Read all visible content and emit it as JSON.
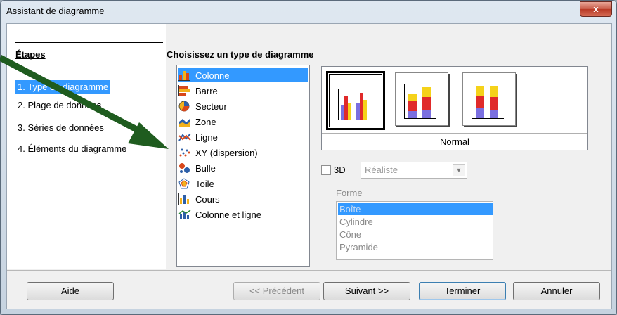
{
  "window": {
    "title": "Assistant de diagramme",
    "close_glyph": "x"
  },
  "steps": {
    "heading": "Étapes",
    "items": [
      {
        "label": "1. Type du diagramme",
        "active": true
      },
      {
        "label": "2. Plage de données",
        "active": false
      },
      {
        "label": "3. Séries de données",
        "active": false
      },
      {
        "label": "4. Éléments du diagramme",
        "active": false
      }
    ]
  },
  "main": {
    "heading": "Choisissez un type de diagramme",
    "types": [
      {
        "label": "Colonne",
        "icon": "column-chart-icon",
        "selected": true
      },
      {
        "label": "Barre",
        "icon": "bar-chart-icon",
        "selected": false
      },
      {
        "label": "Secteur",
        "icon": "pie-chart-icon",
        "selected": false
      },
      {
        "label": "Zone",
        "icon": "area-chart-icon",
        "selected": false
      },
      {
        "label": "Ligne",
        "icon": "line-chart-icon",
        "selected": false
      },
      {
        "label": "XY (dispersion)",
        "icon": "scatter-chart-icon",
        "selected": false
      },
      {
        "label": "Bulle",
        "icon": "bubble-chart-icon",
        "selected": false
      },
      {
        "label": "Toile",
        "icon": "net-chart-icon",
        "selected": false
      },
      {
        "label": "Cours",
        "icon": "stock-chart-icon",
        "selected": false
      },
      {
        "label": "Colonne et ligne",
        "icon": "column-line-chart-icon",
        "selected": false
      }
    ],
    "variant_label": "Normal",
    "variants": [
      {
        "name": "normal-variant",
        "selected": true
      },
      {
        "name": "stacked-variant",
        "selected": false
      },
      {
        "name": "percent-stacked-variant",
        "selected": false
      }
    ],
    "three_d": {
      "label": "3D",
      "checked": false,
      "mode": "Réaliste"
    },
    "forme": {
      "label": "Forme",
      "options": [
        "Boîte",
        "Cylindre",
        "Cône",
        "Pyramide"
      ],
      "selected": "Boîte"
    }
  },
  "buttons": {
    "help": "Aide",
    "previous": "<< Précédent",
    "next": "Suivant >>",
    "finish": "Terminer",
    "cancel": "Annuler"
  },
  "colors": {
    "selection": "#3399ff",
    "arrow": "#1f5c1f"
  }
}
